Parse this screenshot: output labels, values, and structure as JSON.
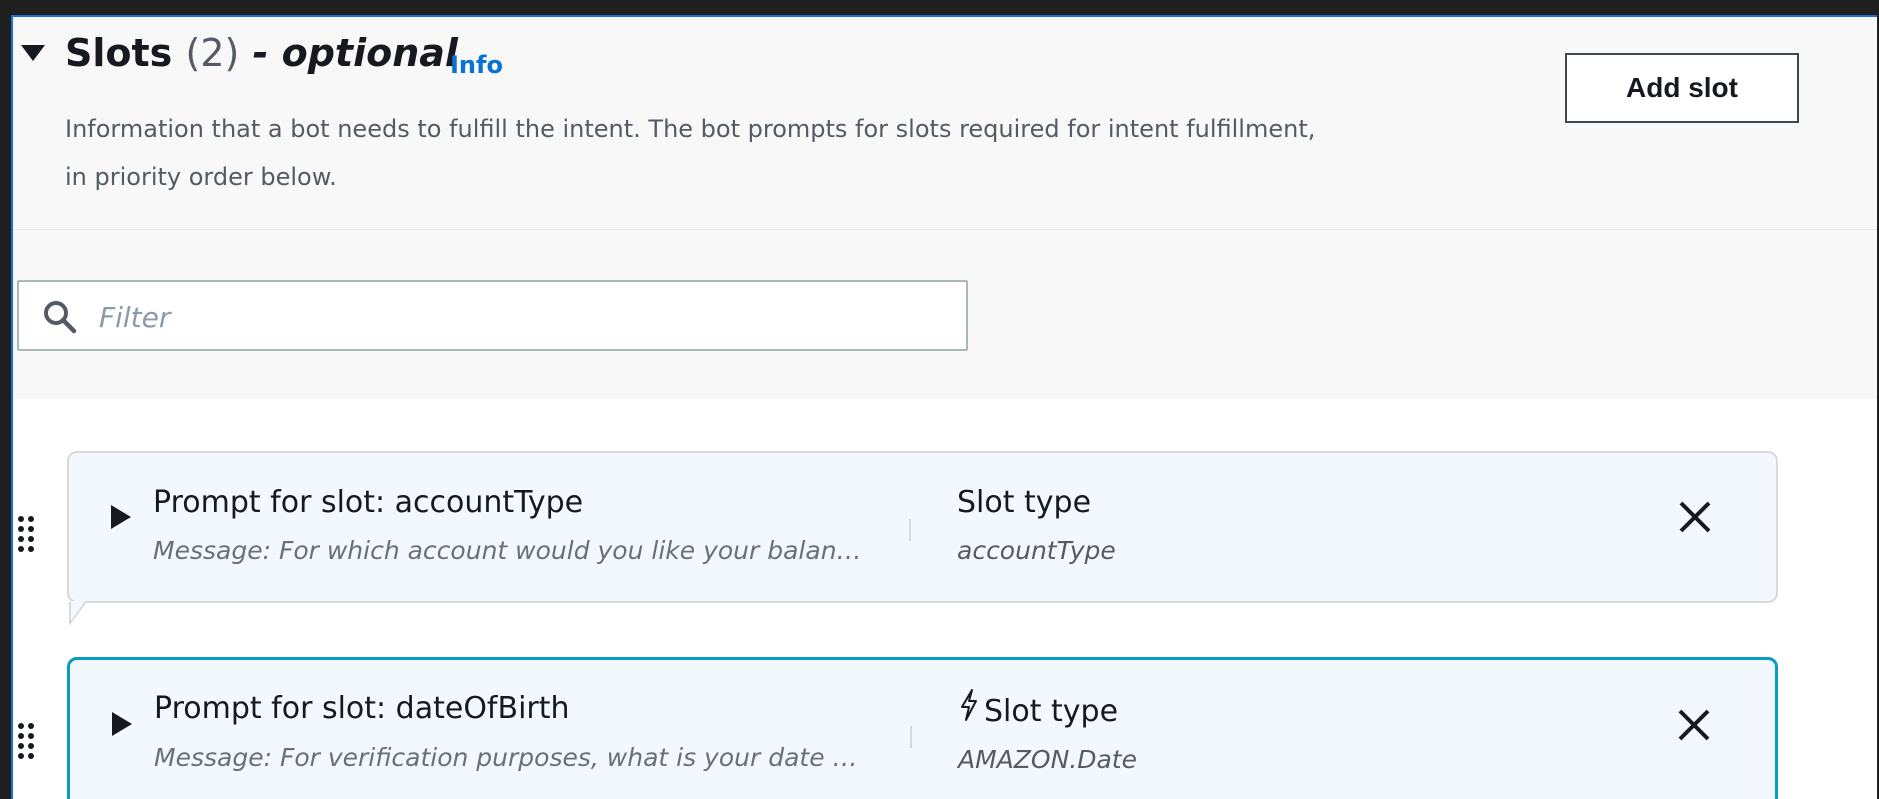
{
  "section": {
    "title": "Slots",
    "count": "(2)",
    "optional": "- optional",
    "info_link": "Info",
    "description": "Information that a bot needs to fulfill the intent. The bot prompts for slots required for intent fulfillment, in priority order below.",
    "add_slot_label": "Add slot"
  },
  "filter": {
    "placeholder": "Filter",
    "value": ""
  },
  "slots": [
    {
      "prompt_title": "Prompt for slot: accountType",
      "message": "Message: For which account would you like your balan…",
      "slot_type_label": "Slot type",
      "slot_type_value": "accountType"
    },
    {
      "prompt_title": "Prompt for slot: dateOfBirth",
      "message": "Message: For verification purposes, what is your date …",
      "slot_type_label": "Slot type",
      "slot_type_value": "AMAZON.Date"
    }
  ],
  "icons": {
    "collapse": "caret-down-icon",
    "search": "search-icon",
    "drag": "drag-handle-icon",
    "expand": "caret-right-icon",
    "remove": "close-icon",
    "builtin": "lightning-icon"
  },
  "colors": {
    "link": "#0972d3",
    "focus_border": "#0a9bc0",
    "card_bg": "#f2f8fd"
  }
}
